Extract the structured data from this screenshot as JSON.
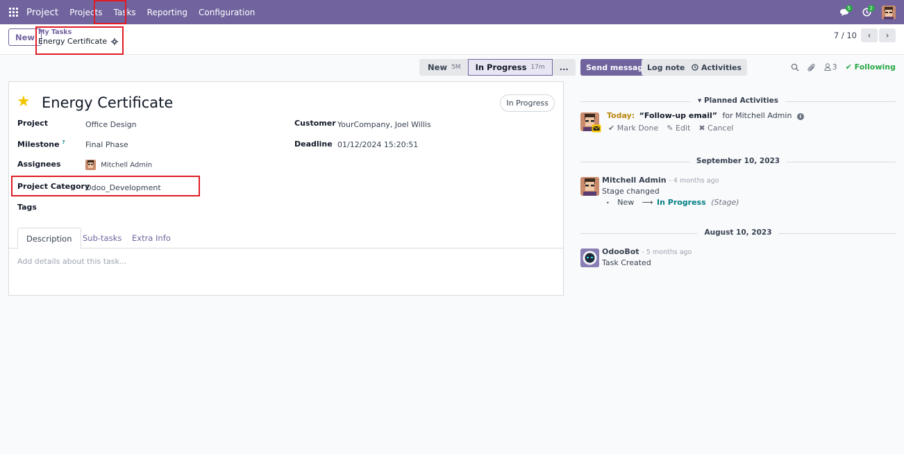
{
  "navbar": {
    "app_name": "Project",
    "menu": [
      "Projects",
      "Tasks",
      "Reporting",
      "Configuration"
    ],
    "messages_badge": "5",
    "activities_badge": "2",
    "bg_color": "#71639e"
  },
  "control": {
    "new_label": "New",
    "breadcrumb_parent": "My Tasks",
    "breadcrumb_current": "Energy Certificate",
    "pager": "7 / 10"
  },
  "statusbar": {
    "stages": [
      {
        "label": "New",
        "time": "5M"
      },
      {
        "label": "In Progress",
        "time": "17m"
      },
      {
        "label": "..."
      }
    ],
    "active_stage": "In Progress"
  },
  "form": {
    "title": "Energy Certificate",
    "stage_badge": "In Progress",
    "fields": {
      "project_label": "Project",
      "project_value": "Office Design",
      "milestone_label": "Milestone",
      "milestone_help": "?",
      "milestone_value": "Final Phase",
      "assignees_label": "Assignees",
      "assignees_value": "Mitchell Admin",
      "category_label": "Project Category",
      "category_value": "Odoo_Development",
      "tags_label": "Tags",
      "customer_label": "Customer",
      "customer_value": "YourCompany, Joel Willis",
      "deadline_label": "Deadline",
      "deadline_value": "01/12/2024 15:20:51"
    },
    "tabs": [
      "Description",
      "Sub-tasks",
      "Extra Info"
    ],
    "description_placeholder": "Add details about this task..."
  },
  "chatter": {
    "send_message": "Send message",
    "log_note": "Log note",
    "activities": "Activities",
    "followers_count": "3",
    "following": "Following",
    "planned_header": "Planned Activities",
    "activity": {
      "when": "Today:",
      "summary": "“Follow-up email”",
      "for": "for Mitchell Admin",
      "mark_done": "Mark Done",
      "edit": "Edit",
      "cancel": "Cancel"
    },
    "date1": "September 10, 2023",
    "msg1": {
      "author": "Mitchell Admin",
      "date": "- 4 months ago",
      "text": "Stage changed",
      "from": "New",
      "to": "In Progress",
      "field": "(Stage)"
    },
    "date2": "August 10, 2023",
    "msg2": {
      "author": "OdooBot",
      "date": "- 5 months ago",
      "text": "Task Created"
    }
  }
}
